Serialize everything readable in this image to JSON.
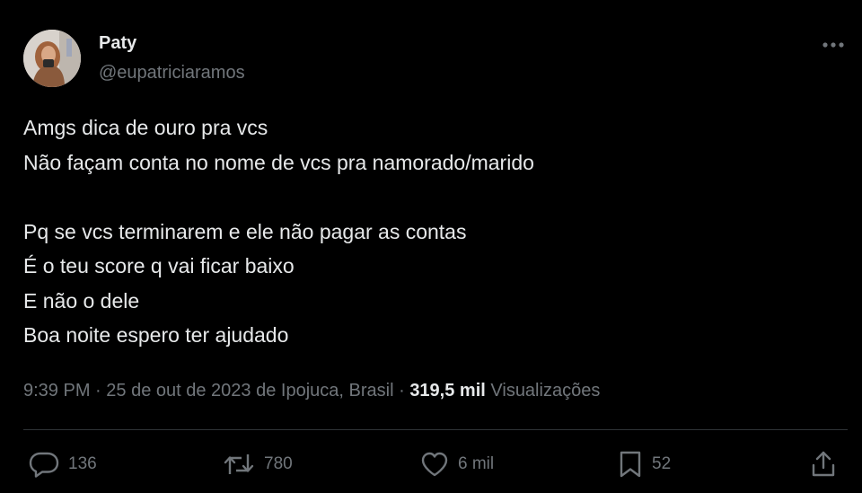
{
  "author": {
    "name": "Paty",
    "handle": "@eupatriciaramos"
  },
  "tweet": {
    "lines": [
      "Amgs dica de ouro pra vcs",
      "Não façam conta no nome de vcs pra namorado/marido",
      "",
      "Pq se vcs terminarem e ele não pagar as contas",
      "É o teu score q vai ficar baixo",
      "E não o dele",
      "Boa noite espero ter ajudado"
    ]
  },
  "meta": {
    "time": "9:39 PM",
    "date_location": "25 de out de 2023 de Ipojuca, Brasil",
    "separator": "·",
    "views_count": "319,5 mil",
    "views_label": "Visualizações"
  },
  "actions": {
    "replies": "136",
    "retweets": "780",
    "likes": "6 mil",
    "bookmarks": "52"
  },
  "icons": [
    "more-icon",
    "reply-icon",
    "retweet-icon",
    "like-icon",
    "bookmark-icon",
    "share-icon"
  ],
  "colors": {
    "background": "#000000",
    "text": "#e7e9ea",
    "secondary": "#71767b",
    "divider": "#2f3336"
  }
}
